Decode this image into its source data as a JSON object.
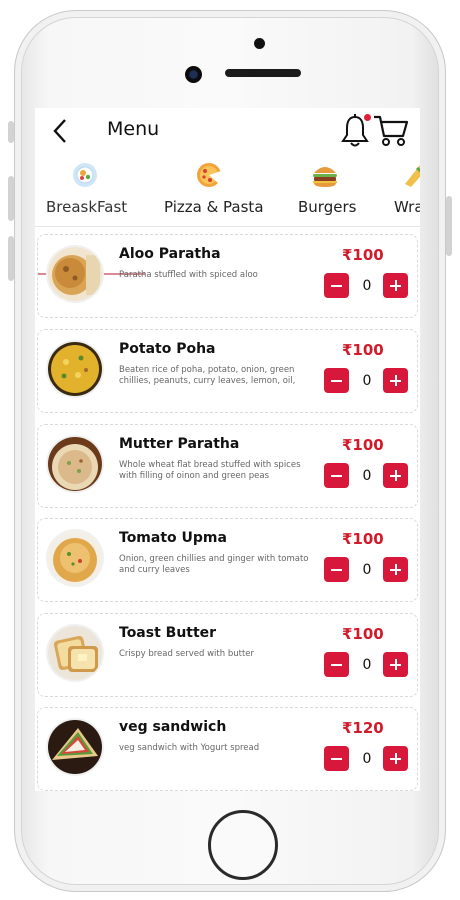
{
  "header": {
    "title": "Menu"
  },
  "categories": [
    {
      "label": "BreaskFast",
      "icon": "breakfast-icon",
      "active": true
    },
    {
      "label": "Pizza & Pasta",
      "icon": "pizza-icon",
      "active": false
    },
    {
      "label": "Burgers",
      "icon": "burger-icon",
      "active": false
    },
    {
      "label": "Wra",
      "icon": "wrap-icon",
      "active": false
    }
  ],
  "items": [
    {
      "name": "Aloo Paratha",
      "desc": "Paratha stuffled with spiced aloo",
      "price": "₹100",
      "qty": "0"
    },
    {
      "name": "Potato Poha",
      "desc": "Beaten rice of poha, potato, onion, green chillies, peanuts, curry leaves, lemon, oil,",
      "price": "₹100",
      "qty": "0"
    },
    {
      "name": "Mutter Paratha",
      "desc": "Whole wheat flat bread stuffed with spices with filling of oinon and green peas",
      "price": "₹100",
      "qty": "0"
    },
    {
      "name": "Tomato Upma",
      "desc": "Onion, green chillies and ginger with tomato and curry leaves",
      "price": "₹100",
      "qty": "0"
    },
    {
      "name": "Toast Butter",
      "desc": "Crispy bread served with butter",
      "price": "₹100",
      "qty": "0"
    },
    {
      "name": "veg sandwich",
      "desc": "veg sandwich with Yogurt spread",
      "price": "₹120",
      "qty": "0"
    }
  ],
  "colors": {
    "accent": "#d8183a",
    "price": "#d11a2a",
    "tab_underline": "#d98b93"
  }
}
